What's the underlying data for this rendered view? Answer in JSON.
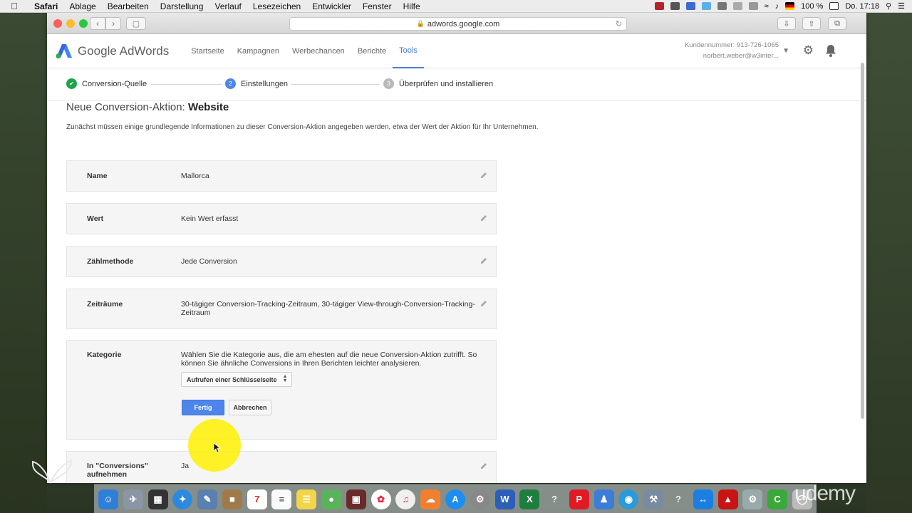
{
  "menubar": {
    "app": "Safari",
    "items": [
      "Ablage",
      "Bearbeiten",
      "Darstellung",
      "Verlauf",
      "Lesezeichen",
      "Entwickler",
      "Fenster",
      "Hilfe"
    ],
    "battery": "100 %",
    "clock": "Do. 17:18"
  },
  "browser": {
    "url": "adwords.google.com"
  },
  "header": {
    "logo_text": "Google AdWords",
    "nav": [
      "Startseite",
      "Kampagnen",
      "Werbechancen",
      "Berichte",
      "Tools"
    ],
    "active_nav": "Tools",
    "customer_number": "Kundennummer: 913-726-1065",
    "account_email": "norbert.weber@w3inter..."
  },
  "stepper": {
    "steps": [
      {
        "label": "Conversion-Quelle",
        "state": "done",
        "number": ""
      },
      {
        "label": "Einstellungen",
        "state": "current",
        "number": "2"
      },
      {
        "label": "Überprüfen und installieren",
        "state": "pending",
        "number": "3"
      }
    ]
  },
  "page": {
    "title_prefix": "Neue Conversion-Aktion:",
    "title_strong": "Website",
    "intro": "Zunächst müssen einige grundlegende Informationen zu dieser Conversion-Aktion angegeben werden, etwa der Wert der Aktion für Ihr Unternehmen."
  },
  "fields": {
    "name": {
      "label": "Name",
      "value": "Mallorca"
    },
    "wert": {
      "label": "Wert",
      "value": "Kein Wert erfasst"
    },
    "zaehlmethode": {
      "label": "Zählmethode",
      "value": "Jede Conversion"
    },
    "zeitraeume": {
      "label": "Zeiträume",
      "value": "30-tägiger Conversion-Tracking-Zeitraum, 30-tägiger View-through-Conversion-Tracking-Zeitraum"
    },
    "kategorie": {
      "label": "Kategorie",
      "description": "Wählen Sie die Kategorie aus, die am ehesten auf die neue Conversion-Aktion zutrifft. So können Sie ähnliche Conversions in Ihren Berichten leichter analysieren.",
      "selected": "Aufrufen einer Schlüsselseite",
      "done_label": "Fertig",
      "cancel_label": "Abbrechen"
    },
    "in_conversions": {
      "label_line1": "In \"Conversions\"",
      "label_line2": "aufnehmen",
      "value": "Ja"
    }
  },
  "overlay": {
    "watermark": "udemy"
  },
  "colors": {
    "accent_blue": "#4d85ea",
    "done_green": "#1fa34a",
    "adwords_blue": "#4a7ed8"
  },
  "icons": [
    "apple-icon",
    "lock-icon",
    "reload-icon",
    "gear-icon",
    "bell-icon",
    "pencil-icon",
    "checkmark-icon",
    "chevron-down-icon"
  ]
}
